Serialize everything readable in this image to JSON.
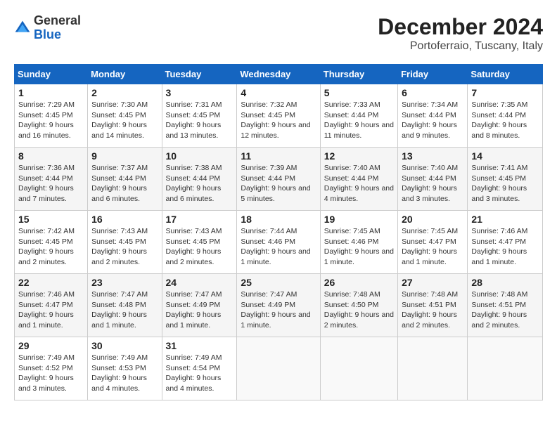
{
  "header": {
    "logo_general": "General",
    "logo_blue": "Blue",
    "title": "December 2024",
    "subtitle": "Portoferraio, Tuscany, Italy"
  },
  "calendar": {
    "days_of_week": [
      "Sunday",
      "Monday",
      "Tuesday",
      "Wednesday",
      "Thursday",
      "Friday",
      "Saturday"
    ],
    "weeks": [
      [
        null,
        null,
        null,
        null,
        null,
        null,
        null
      ]
    ],
    "cells": [
      [
        {
          "day": "1",
          "sunrise": "7:29 AM",
          "sunset": "4:45 PM",
          "daylight": "9 hours and 16 minutes."
        },
        {
          "day": "2",
          "sunrise": "7:30 AM",
          "sunset": "4:45 PM",
          "daylight": "9 hours and 14 minutes."
        },
        {
          "day": "3",
          "sunrise": "7:31 AM",
          "sunset": "4:45 PM",
          "daylight": "9 hours and 13 minutes."
        },
        {
          "day": "4",
          "sunrise": "7:32 AM",
          "sunset": "4:45 PM",
          "daylight": "9 hours and 12 minutes."
        },
        {
          "day": "5",
          "sunrise": "7:33 AM",
          "sunset": "4:44 PM",
          "daylight": "9 hours and 11 minutes."
        },
        {
          "day": "6",
          "sunrise": "7:34 AM",
          "sunset": "4:44 PM",
          "daylight": "9 hours and 9 minutes."
        },
        {
          "day": "7",
          "sunrise": "7:35 AM",
          "sunset": "4:44 PM",
          "daylight": "9 hours and 8 minutes."
        }
      ],
      [
        {
          "day": "8",
          "sunrise": "7:36 AM",
          "sunset": "4:44 PM",
          "daylight": "9 hours and 7 minutes."
        },
        {
          "day": "9",
          "sunrise": "7:37 AM",
          "sunset": "4:44 PM",
          "daylight": "9 hours and 6 minutes."
        },
        {
          "day": "10",
          "sunrise": "7:38 AM",
          "sunset": "4:44 PM",
          "daylight": "9 hours and 6 minutes."
        },
        {
          "day": "11",
          "sunrise": "7:39 AM",
          "sunset": "4:44 PM",
          "daylight": "9 hours and 5 minutes."
        },
        {
          "day": "12",
          "sunrise": "7:40 AM",
          "sunset": "4:44 PM",
          "daylight": "9 hours and 4 minutes."
        },
        {
          "day": "13",
          "sunrise": "7:40 AM",
          "sunset": "4:44 PM",
          "daylight": "9 hours and 3 minutes."
        },
        {
          "day": "14",
          "sunrise": "7:41 AM",
          "sunset": "4:45 PM",
          "daylight": "9 hours and 3 minutes."
        }
      ],
      [
        {
          "day": "15",
          "sunrise": "7:42 AM",
          "sunset": "4:45 PM",
          "daylight": "9 hours and 2 minutes."
        },
        {
          "day": "16",
          "sunrise": "7:43 AM",
          "sunset": "4:45 PM",
          "daylight": "9 hours and 2 minutes."
        },
        {
          "day": "17",
          "sunrise": "7:43 AM",
          "sunset": "4:45 PM",
          "daylight": "9 hours and 2 minutes."
        },
        {
          "day": "18",
          "sunrise": "7:44 AM",
          "sunset": "4:46 PM",
          "daylight": "9 hours and 1 minute."
        },
        {
          "day": "19",
          "sunrise": "7:45 AM",
          "sunset": "4:46 PM",
          "daylight": "9 hours and 1 minute."
        },
        {
          "day": "20",
          "sunrise": "7:45 AM",
          "sunset": "4:47 PM",
          "daylight": "9 hours and 1 minute."
        },
        {
          "day": "21",
          "sunrise": "7:46 AM",
          "sunset": "4:47 PM",
          "daylight": "9 hours and 1 minute."
        }
      ],
      [
        {
          "day": "22",
          "sunrise": "7:46 AM",
          "sunset": "4:47 PM",
          "daylight": "9 hours and 1 minute."
        },
        {
          "day": "23",
          "sunrise": "7:47 AM",
          "sunset": "4:48 PM",
          "daylight": "9 hours and 1 minute."
        },
        {
          "day": "24",
          "sunrise": "7:47 AM",
          "sunset": "4:49 PM",
          "daylight": "9 hours and 1 minute."
        },
        {
          "day": "25",
          "sunrise": "7:47 AM",
          "sunset": "4:49 PM",
          "daylight": "9 hours and 1 minute."
        },
        {
          "day": "26",
          "sunrise": "7:48 AM",
          "sunset": "4:50 PM",
          "daylight": "9 hours and 2 minutes."
        },
        {
          "day": "27",
          "sunrise": "7:48 AM",
          "sunset": "4:51 PM",
          "daylight": "9 hours and 2 minutes."
        },
        {
          "day": "28",
          "sunrise": "7:48 AM",
          "sunset": "4:51 PM",
          "daylight": "9 hours and 2 minutes."
        }
      ],
      [
        {
          "day": "29",
          "sunrise": "7:49 AM",
          "sunset": "4:52 PM",
          "daylight": "9 hours and 3 minutes."
        },
        {
          "day": "30",
          "sunrise": "7:49 AM",
          "sunset": "4:53 PM",
          "daylight": "9 hours and 4 minutes."
        },
        {
          "day": "31",
          "sunrise": "7:49 AM",
          "sunset": "4:54 PM",
          "daylight": "9 hours and 4 minutes."
        },
        null,
        null,
        null,
        null
      ]
    ]
  }
}
